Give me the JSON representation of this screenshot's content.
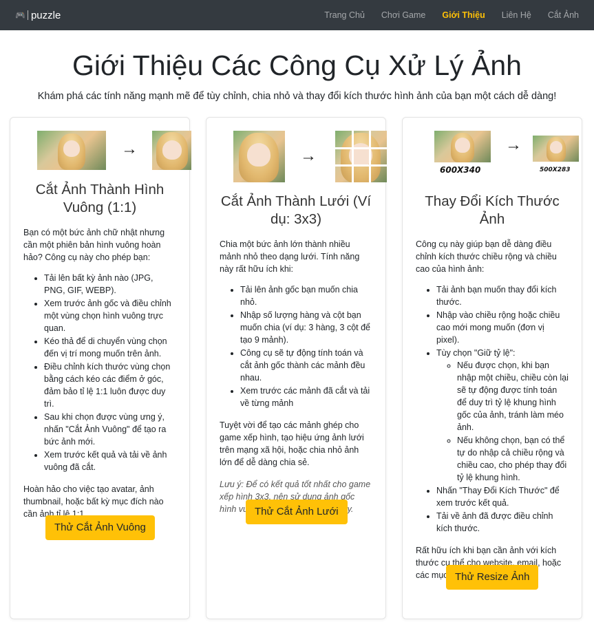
{
  "navbar": {
    "brand": "puzzle",
    "links": [
      "Trang Chủ",
      "Chơi Game",
      "Giới Thiệu",
      "Liên Hệ",
      "Cắt Ảnh"
    ]
  },
  "hero": {
    "title": "Giới Thiệu Các Công Cụ Xử Lý Ảnh",
    "subtitle": "Khám phá các tính năng mạnh mẽ để tùy chỉnh, chia nhỏ và thay đổi kích thước hình ảnh của bạn một cách dễ dàng!"
  },
  "cards": [
    {
      "title": "Cắt Ảnh Thành Hình Vuông (1:1)",
      "intro": "Bạn có một bức ảnh chữ nhật nhưng cần một phiên bản hình vuông hoàn hảo? Công cụ này cho phép bạn:",
      "items": [
        "Tải lên bất kỳ ảnh nào (JPG, PNG, GIF, WEBP).",
        "Xem trước ảnh gốc và điều chỉnh một vùng chọn hình vuông trực quan.",
        "Kéo thả để di chuyển vùng chọn đến vị trí mong muốn trên ảnh.",
        "Điều chỉnh kích thước vùng chọn bằng cách kéo các điểm ở góc, đảm bảo tỉ lệ 1:1 luôn được duy trì.",
        "Sau khi chọn được vùng ưng ý, nhấn \"Cắt Ảnh Vuông\" để tạo ra bức ảnh mới.",
        "Xem trước kết quả và tải về ảnh vuông đã cắt."
      ],
      "outro": "Hoàn hảo cho việc tạo avatar, ảnh thumbnail, hoặc bất kỳ mục đích nào cần ảnh tỉ lệ 1:1.",
      "button": "Thử Cắt Ảnh Vuông"
    },
    {
      "title": "Cắt Ảnh Thành Lưới (Ví dụ: 3x3)",
      "intro": "Chia một bức ảnh lớn thành nhiều mảnh nhỏ theo dạng lưới. Tính năng này rất hữu ích khi:",
      "items": [
        "Tải lên ảnh gốc bạn muốn chia nhỏ.",
        "Nhập số lượng hàng và cột bạn muốn chia (ví dụ: 3 hàng, 3 cột để tạo 9 mảnh).",
        "Công cụ sẽ tự động tính toán và cắt ảnh gốc thành các mảnh đều nhau.",
        "Xem trước các mảnh đã cắt và tải về từng mảnh"
      ],
      "outro": "Tuyệt vời để tạo các mảnh ghép cho game xếp hình, tạo hiệu ứng ảnh lưới trên mạng xã hội, hoặc chia nhỏ ảnh lớn để dễ dàng chia sẻ.",
      "note": "Lưu ý: Để có kết quả tốt nhất cho game xếp hình 3x3, nên sử dụng ảnh gốc hình vuông khi dùng tính năng này.",
      "button": "Thử Cắt Ảnh Lưới"
    },
    {
      "title": "Thay Đổi Kích Thước Ảnh",
      "intro": "Công cụ này giúp bạn dễ dàng điều chỉnh kích thước chiều rộng và chiều cao của hình ảnh:",
      "items": [
        "Tải ảnh bạn muốn thay đổi kích thước.",
        "Nhập vào chiều rộng hoặc chiều cao mới mong muốn (đơn vị pixel).",
        "Tùy chọn \"Giữ tỷ lệ\":",
        "Nhấn \"Thay Đổi Kích Thước\" để xem trước kết quả.",
        "Tải về ảnh đã được điều chỉnh kích thước."
      ],
      "subitems": [
        "Nếu được chọn, khi bạn nhập một chiều, chiều còn lại sẽ tự động được tính toán để duy trì tỷ lệ khung hình gốc của ảnh, tránh làm méo ảnh.",
        "Nếu không chọn, bạn có thể tự do nhập cả chiều rộng và chiều cao, cho phép thay đổi tỷ lệ khung hình."
      ],
      "outro": "Rất hữu ích khi bạn cần ảnh với kích thước cụ thể cho website, email, hoặc các mục đích khác.",
      "button": "Thử Resize Ảnh",
      "size_before": "600X340",
      "size_after": "500X283"
    }
  ]
}
